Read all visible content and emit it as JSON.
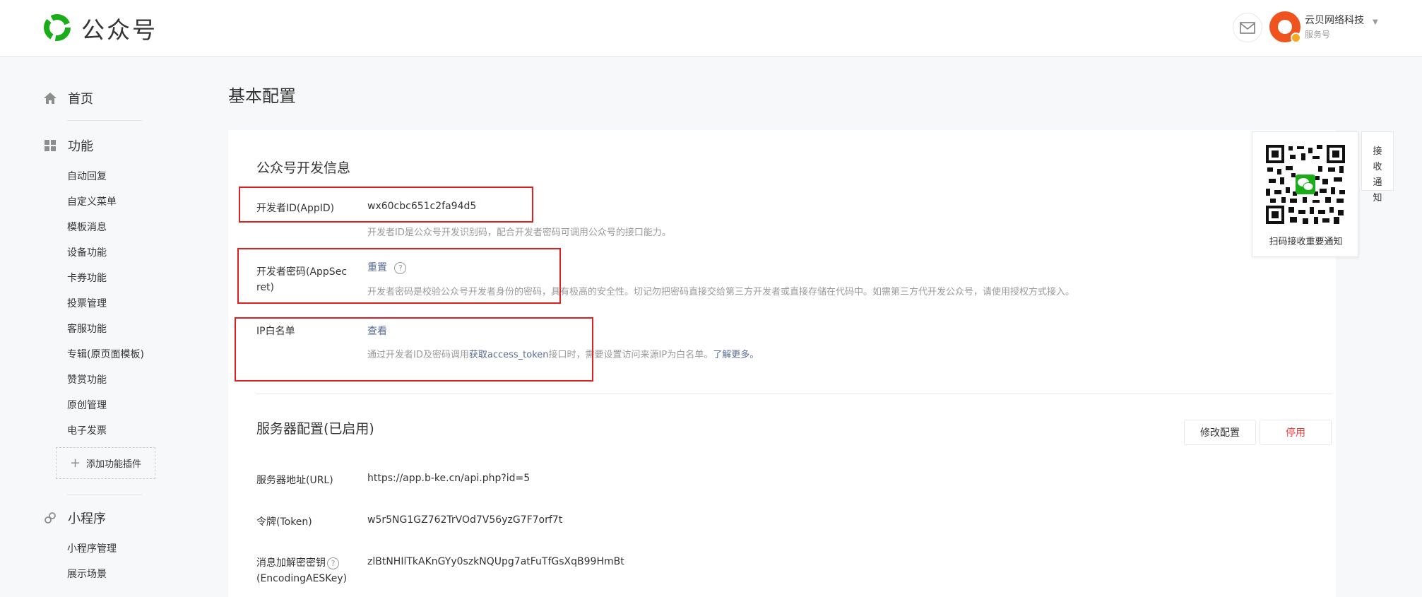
{
  "header": {
    "logo_text": "公众号",
    "account_name": "云贝网络科技",
    "account_type": "服务号"
  },
  "sidebar": {
    "home": "首页",
    "features": {
      "label": "功能",
      "items": [
        "自动回复",
        "自定义菜单",
        "模板消息",
        "设备功能",
        "卡券功能",
        "投票管理",
        "客服功能",
        "专辑(原页面模板)",
        "赞赏功能",
        "原创管理",
        "电子发票"
      ],
      "add_plugin": "添加功能插件"
    },
    "miniprogram": {
      "label": "小程序",
      "items": [
        "小程序管理",
        "展示场景"
      ]
    }
  },
  "main": {
    "page_title": "基本配置",
    "dev_info": {
      "title": "公众号开发信息",
      "appid_label": "开发者ID(AppID)",
      "appid_value": "wx60cbc651c2fa94d5",
      "appid_desc": "开发者ID是公众号开发识别码，配合开发者密码可调用公众号的接口能力。",
      "secret_label_1": "开发者密码(AppSec",
      "secret_label_2": "ret)",
      "secret_link": "重置",
      "secret_help": "?",
      "secret_desc": "开发者密码是校验公众号开发者身份的密码，具有极高的安全性。切记勿把密码直接交给第三方开发者或直接存储在代码中。如需第三方代开发公众号，请使用授权方式接入。",
      "ip_label": "IP白名单",
      "ip_link": "查看",
      "ip_desc_1": "通过开发者ID及密码调用",
      "ip_desc_link": "获取access_token",
      "ip_desc_2": "接口时，需要设置访问来源IP为白名单。",
      "ip_desc_more": "了解更多。"
    },
    "server": {
      "title": "服务器配置(已启用)",
      "modify_button": "修改配置",
      "disable_button": "停用",
      "url_label": "服务器地址(URL)",
      "url_value": "https://app.b-ke.cn/api.php?id=5",
      "token_label": "令牌(Token)",
      "token_value": "w5r5NG1GZ762TrVOd7V56yzG7F7orf7t",
      "aes_label_1": "消息加解密密钥",
      "aes_help": "?",
      "aes_label_2": "(EncodingAESKey)",
      "aes_value": "zlBtNHIlTkAKnGYy0szkNQUpg7atFuTfGsXqB99HmBt"
    }
  },
  "qr_widget": {
    "caption": "扫码接收重要通知",
    "side_tab": "接收通知"
  },
  "colors": {
    "brand_green": "#1aad19",
    "link_blue": "#576b95",
    "highlight_red": "#e02020",
    "danger_red": "#e64340"
  }
}
